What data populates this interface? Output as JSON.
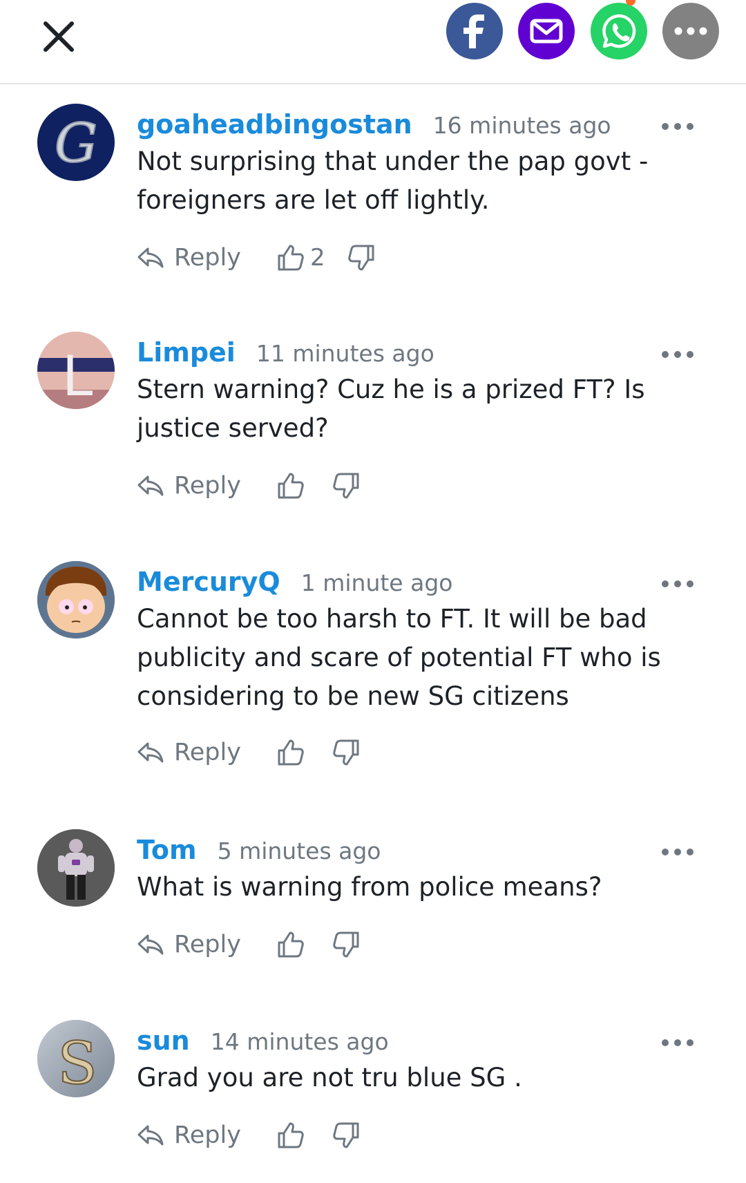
{
  "header": {
    "close_icon": "close-icon",
    "share_buttons": [
      {
        "name": "facebook",
        "color": "#3b5998"
      },
      {
        "name": "email",
        "color": "#6001d2"
      },
      {
        "name": "whatsapp",
        "color": "#25d366"
      },
      {
        "name": "more",
        "color": "#828282"
      }
    ]
  },
  "comments": [
    {
      "username": "goaheadbingostan",
      "time": "16 minutes ago",
      "text": "Not surprising that under the pap govt - foreigners are let off lightly.",
      "reply_label": "Reply",
      "upvotes": "2",
      "avatar_letter": "G"
    },
    {
      "username": "Limpei",
      "time": "11 minutes ago",
      "text": "Stern warning? Cuz he is a prized FT? Is justice served?",
      "reply_label": "Reply",
      "upvotes": "",
      "avatar_letter": "L"
    },
    {
      "username": "MercuryQ",
      "time": "1 minute ago",
      "text": "Cannot be too harsh to FT. It will be bad publicity and scare of potential FT who is considering to be new SG citizens",
      "reply_label": "Reply",
      "upvotes": "",
      "avatar_letter": ""
    },
    {
      "username": "Tom",
      "time": "5 minutes ago",
      "text": "What is warning from police means?",
      "reply_label": "Reply",
      "upvotes": "",
      "avatar_letter": ""
    },
    {
      "username": "sun",
      "time": "14 minutes ago",
      "text": "Grad you are not tru blue SG .",
      "reply_label": "Reply",
      "upvotes": "",
      "avatar_letter": "S"
    }
  ],
  "colors": {
    "accent": "#1a8bdb",
    "muted": "#6e7780",
    "text": "#1d2228"
  }
}
